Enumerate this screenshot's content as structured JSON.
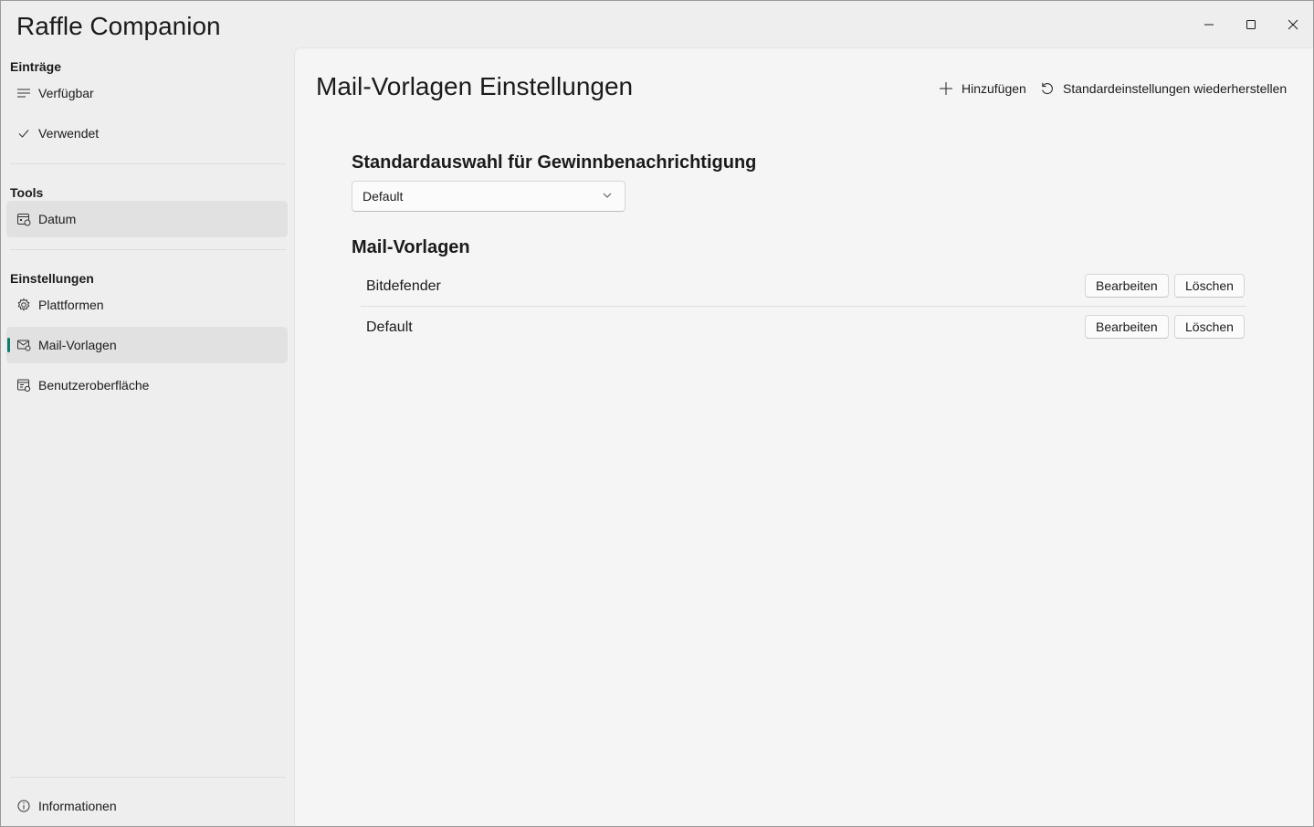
{
  "app": {
    "title": "Raffle Companion"
  },
  "sidebar": {
    "sections": [
      {
        "header": "Einträge",
        "items": [
          {
            "label": "Verfügbar",
            "icon": "list-icon"
          },
          {
            "label": "Verwendet",
            "icon": "checkmark-icon"
          }
        ]
      },
      {
        "header": "Tools",
        "items": [
          {
            "label": "Datum",
            "icon": "calendar-icon"
          }
        ]
      },
      {
        "header": "Einstellungen",
        "items": [
          {
            "label": "Plattformen",
            "icon": "gear-icon"
          },
          {
            "label": "Mail-Vorlagen",
            "icon": "mail-icon",
            "selected": true
          },
          {
            "label": "Benutzeroberfläche",
            "icon": "window-settings-icon"
          }
        ]
      }
    ],
    "footer": {
      "label": "Informationen",
      "icon": "info-icon"
    }
  },
  "main": {
    "title": "Mail-Vorlagen Einstellungen",
    "commands": {
      "add_label": "Hinzufügen",
      "reset_label": "Standardeinstellungen wiederherstellen"
    },
    "default_selection": {
      "heading": "Standardauswahl für Gewinnbenachrichtigung",
      "value": "Default"
    },
    "templates": {
      "heading": "Mail-Vorlagen",
      "edit_label": "Bearbeiten",
      "delete_label": "Löschen",
      "items": [
        {
          "name": "Bitdefender"
        },
        {
          "name": "Default"
        }
      ]
    }
  },
  "colors": {
    "accent": "#0f7b6c",
    "content_background": "#f5f5f5",
    "sidebar_background": "#eeeeee",
    "selected_item": "#e1e1e1"
  }
}
